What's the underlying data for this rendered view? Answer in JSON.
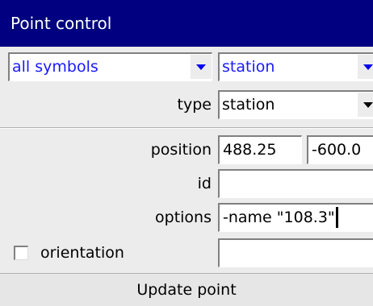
{
  "title": "Point control",
  "symbol_filter": {
    "value": "all symbols"
  },
  "symbol_select": {
    "value": "station"
  },
  "type": {
    "label": "type",
    "value": "station"
  },
  "position": {
    "label": "position",
    "x": "488.25",
    "y": "-600.0"
  },
  "id": {
    "label": "id",
    "value": ""
  },
  "options": {
    "label": "options",
    "value": "-name \"108.3\""
  },
  "orientation": {
    "label": "orientation",
    "checked": false,
    "value": ""
  },
  "update_button": {
    "label": "Update point"
  }
}
